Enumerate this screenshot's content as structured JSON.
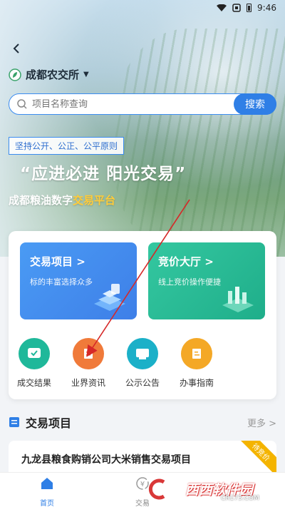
{
  "status_bar": {
    "time": "9:46"
  },
  "header": {
    "location": "成都农交所",
    "search_placeholder": "项目名称查询",
    "search_button": "搜索"
  },
  "hero": {
    "principle": "坚持公开、公正、公平原则",
    "slogan": "“应进必进 阳光交易”",
    "subtitle_prefix": "成都粮油数字",
    "subtitle_highlight": "交易平台"
  },
  "features": [
    {
      "title": "交易项目 >",
      "subtitle": "标的丰富选择众多"
    },
    {
      "title": "竞价大厅 >",
      "subtitle": "线上竞价操作便捷"
    }
  ],
  "quick_links": [
    {
      "label": "成交结果",
      "color": "#1fb89a"
    },
    {
      "label": "业界资讯",
      "color": "#f07a3a"
    },
    {
      "label": "公示公告",
      "color": "#1bb0c8"
    },
    {
      "label": "办事指南",
      "color": "#f4a826"
    }
  ],
  "section": {
    "title": "交易项目",
    "more": "更多 >",
    "item_title": "九龙县粮食购销公司大米销售交易项目",
    "item_badge": "待竞价"
  },
  "tabbar": {
    "home": "首页",
    "trade": "交易"
  },
  "watermark": {
    "text": "西西软件园",
    "url": "CR173.COM"
  },
  "colors": {
    "primary": "#2f7fe6",
    "accent_yellow": "#ffcc3a",
    "annotation_arrow": "#d62828"
  }
}
